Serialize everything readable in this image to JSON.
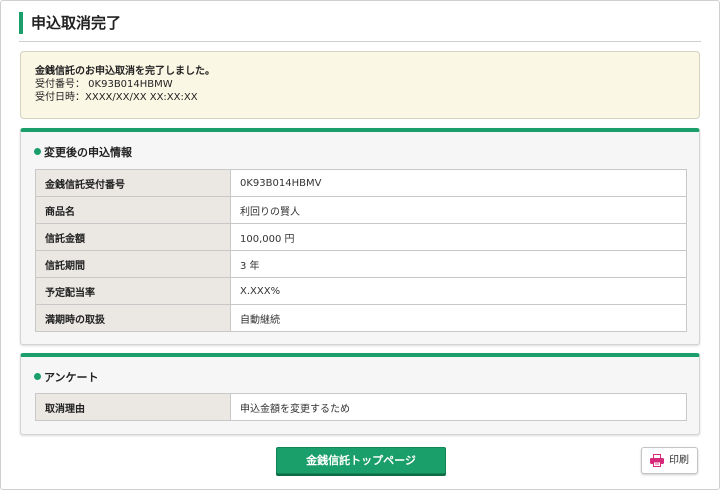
{
  "page": {
    "title": "申込取消完了"
  },
  "notice": {
    "message": "金銭信託のお申込取消を完了しました。",
    "receipt_line": "受付番号： 0K93B014HBMW",
    "datetime_line": "受付日時：XXXX/XX/XX XX:XX:XX"
  },
  "info_section": {
    "heading": "変更後の申込情報",
    "rows": [
      {
        "label": "金銭信託受付番号",
        "value": "0K93B014HBMV"
      },
      {
        "label": "商品名",
        "value": "利回りの賢人"
      },
      {
        "label": "信託金額",
        "value": "100,000 円"
      },
      {
        "label": "信託期間",
        "value": "3 年"
      },
      {
        "label": "予定配当率",
        "value": "X.XXX%"
      },
      {
        "label": "満期時の取扱",
        "value": "自動継続"
      }
    ]
  },
  "survey_section": {
    "heading": "アンケート",
    "rows": [
      {
        "label": "取消理由",
        "value": "申込金額を変更するため"
      }
    ]
  },
  "buttons": {
    "top_page": "金銭信託トップページ",
    "print": "印刷"
  },
  "colors": {
    "accent": "#1a9e6a",
    "notice_bg": "#fbf7e5",
    "print_icon": "#d6297a"
  },
  "icons": {
    "print": "printer-icon"
  }
}
